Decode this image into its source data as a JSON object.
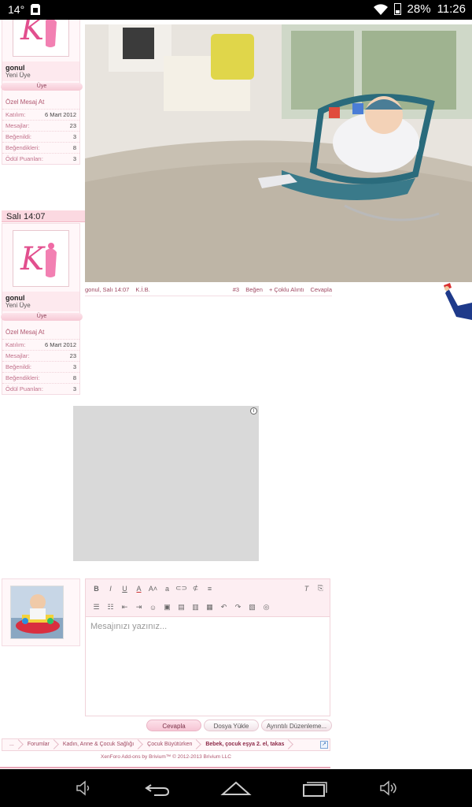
{
  "status_bar": {
    "temperature": "14°",
    "battery_percent": "28%",
    "time": "11:26"
  },
  "user_card_1": {
    "username": "gonul",
    "title": "Yeni Üye",
    "role": "Üye",
    "private_message": "Özel Mesaj At",
    "stats": [
      {
        "label": "Katılım:",
        "value": "6 Mart 2012"
      },
      {
        "label": "Mesajlar:",
        "value": "23"
      },
      {
        "label": "Beğenildi:",
        "value": "3"
      },
      {
        "label": "Beğendikleri:",
        "value": "8"
      },
      {
        "label": "Ödül Puanları:",
        "value": "3"
      }
    ]
  },
  "user_card_2": {
    "timestamp": "Salı 14:07",
    "username": "gonul",
    "title": "Yeni Üye",
    "role": "Üye",
    "private_message": "Özel Mesaj At",
    "stats": [
      {
        "label": "Katılım:",
        "value": "6 Mart 2012"
      },
      {
        "label": "Mesajlar:",
        "value": "23"
      },
      {
        "label": "Beğenildi:",
        "value": "3"
      },
      {
        "label": "Beğendikleri:",
        "value": "8"
      },
      {
        "label": "Ödül Puanları:",
        "value": "3"
      }
    ]
  },
  "post": {
    "author_time": "gonul, Salı 14:07",
    "report": "K.İ.B.",
    "number": "#3",
    "like": "Beğen",
    "multi_quote": "+ Çoklu Alıntı",
    "reply": "Cevapla"
  },
  "ad": {
    "info_symbol": "i"
  },
  "editor": {
    "placeholder": "Mesajınızı yazınız..."
  },
  "actions": {
    "reply": "Cevapla",
    "upload": "Dosya Yükle",
    "advanced": "Ayrıntılı Düzenleme..."
  },
  "breadcrumb": {
    "home": "...",
    "items": [
      "Forumlar",
      "Kadın, Anne & Çocuk Sağlığı",
      "Çocuk Büyütürken",
      "Bebek, çocuk eşya 2. el, takas"
    ]
  },
  "footer": {
    "copyright": "XenForo Add-ons by Brivium™ © 2012-2013 Brivium LLC"
  }
}
